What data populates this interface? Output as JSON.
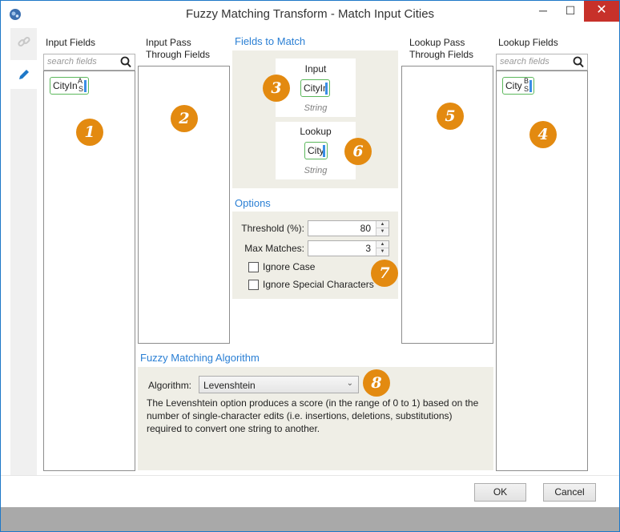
{
  "window": {
    "title": "Fuzzy Matching Transform - Match Input Cities",
    "minimize_glyph": "─",
    "maximize_glyph": "☐",
    "close_glyph": "✕"
  },
  "rail": {
    "icons": [
      "link-icon",
      "pencil-icon"
    ],
    "accent_color": "#1e78c8"
  },
  "columns": {
    "input_fields_label": "Input Fields",
    "input_pass_through_label": "Input Pass\nThrough Fields",
    "lookup_pass_through_label": "Lookup Pass\nThrough Fields",
    "lookup_fields_label": "Lookup Fields"
  },
  "input_fields": {
    "search_placeholder": "search fields",
    "chip": {
      "name": "CityIn",
      "sup": "A",
      "sub": "S"
    }
  },
  "lookup_fields": {
    "search_placeholder": "search fields",
    "chip": {
      "name": "City",
      "sup": "B",
      "sub": "S"
    }
  },
  "fields_to_match": {
    "header": "Fields to Match",
    "input": {
      "label": "Input",
      "field": "CityIn",
      "type": "String"
    },
    "lookup": {
      "label": "Lookup",
      "field": "City",
      "type": "String"
    }
  },
  "options": {
    "header": "Options",
    "threshold_label": "Threshold (%):",
    "threshold_value": "80",
    "max_matches_label": "Max Matches:",
    "max_matches_value": "3",
    "ignore_case_label": "Ignore Case",
    "ignore_case_checked": false,
    "ignore_special_label": "Ignore Special Characters",
    "ignore_special_checked": false
  },
  "algorithm": {
    "header": "Fuzzy Matching Algorithm",
    "label": "Algorithm:",
    "selected": "Levenshtein",
    "description_line1": "The Levenshtein option produces a score (in the range of 0 to 1) based on the",
    "description_line2": "number of single-character edits (i.e. insertions, deletions, substitutions)",
    "description_line3": "required to convert one string to another."
  },
  "badges": [
    "1",
    "2",
    "3",
    "4",
    "5",
    "6",
    "7",
    "8"
  ],
  "badge_color": "#e38a10",
  "footer": {
    "ok_label": "OK",
    "cancel_label": "Cancel"
  },
  "colors": {
    "section_header": "#2a7fd4",
    "panel_bg": "#efeee6",
    "chip_border": "#5cb85c",
    "close_button": "#c7312a"
  }
}
